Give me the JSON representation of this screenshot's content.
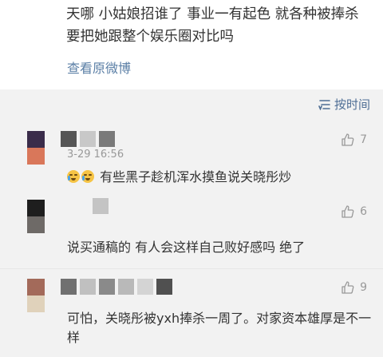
{
  "post": {
    "text": "天哪  小姑娘招谁了  事业一有起色  就各种被捧杀  要把她跟整个娱乐圈对比吗",
    "view_original": "查看原微博"
  },
  "sort": {
    "label": "按时间",
    "icon": "sort-lines-icon"
  },
  "comments": [
    {
      "avatar_colors": [
        "#3a2c4a",
        "#d9775a"
      ],
      "name_colors": [
        "#555555",
        "#c8c8c8",
        "#7a7a7a"
      ],
      "time": "3-29 16:56",
      "emoji": [
        "crying-face-icon",
        "crying-face-icon"
      ],
      "text": "有些黑子趁机浑水摸鱼说关晓彤炒",
      "likes": "7"
    },
    {
      "avatar_colors": [
        "#1e1e1e",
        "#6e6a67"
      ],
      "name_colors": [
        "#c4c4c4"
      ],
      "time": "",
      "text": "说买通稿的  有人会这样自己败好感吗  绝了",
      "likes": "6"
    },
    {
      "avatar_colors": [
        "#a36a5a",
        "#e0d2bb"
      ],
      "name_colors": [
        "#707070",
        "#c0c0c0",
        "#8a8a8a",
        "#b9b9b9",
        "#d4d4d4",
        "#505050"
      ],
      "time": "",
      "text": "可怕，关晓彤被yxh捧杀一周了。对家资本雄厚是不一样",
      "likes": "9"
    }
  ]
}
